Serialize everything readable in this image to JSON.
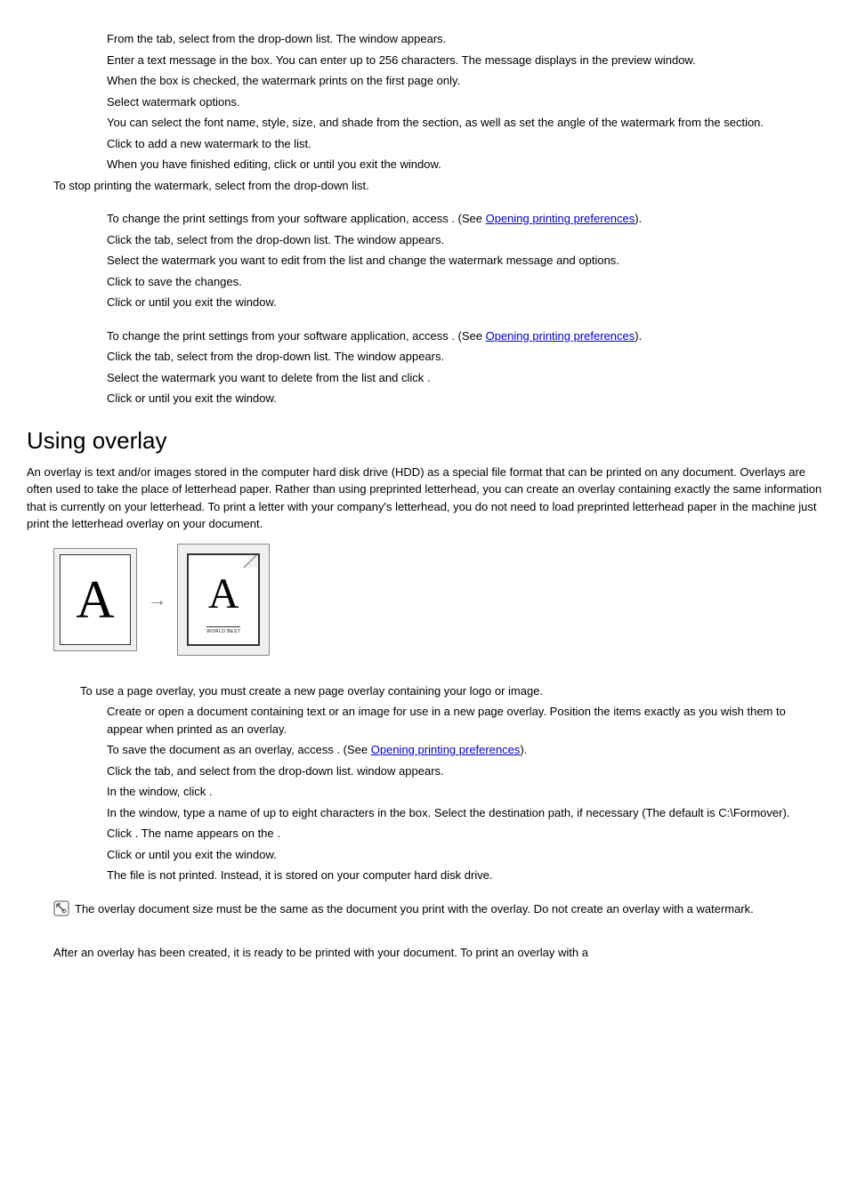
{
  "section1": {
    "p1": "From the tab, select from the drop-down list. The window appears.",
    "p2": "Enter a text message in the box. You can enter up to 256 characters. The message displays in the preview window.",
    "p3": "When the box is checked, the watermark prints on the first page only.",
    "p4": "Select watermark options.",
    "p5": "You can select the font name, style, size, and shade from the section, as well as set the angle of the watermark from the section.",
    "p6": "Click to add a new watermark to the list.",
    "p7": "When you have finished editing, click or until you exit the window.",
    "p8": "To stop printing the watermark, select from the drop-down list."
  },
  "section2": {
    "p1a": "To change the print settings from your software application, access ",
    "p1b": ". (See ",
    "link1": "Opening printing preferences",
    "p1c": ").",
    "p2": "Click the tab, select from the drop-down list. The window appears.",
    "p3": "Select the watermark you want to edit from the list and change the watermark message and options.",
    "p4": "Click to save the changes.",
    "p5": "Click or until you exit the window."
  },
  "section3": {
    "p1a": "To change the print settings from your software application, access ",
    "p1b": ". (See ",
    "link1": "Opening printing preferences",
    "p1c": ").",
    "p2": "Click the tab, select from the drop-down list. The window appears.",
    "p3": "Select the watermark you want to delete from the list and click .",
    "p4": "Click or until you exit the window."
  },
  "heading": "Using overlay",
  "overlay_intro": "An overlay is text and/or images stored in the computer hard disk drive (HDD) as a special file format that can be printed on any document. Overlays are often used to take the place of letterhead paper. Rather than using preprinted letterhead, you can create an overlay containing exactly the same information that is currently on your letterhead. To print a letter with your company's letterhead, you do not need to load preprinted letterhead paper in the machine just print the letterhead overlay on your document.",
  "fig_caption": "WORLD BEST",
  "section4": {
    "intro": "To use a page overlay, you must create a new page overlay containing your logo or image.",
    "p1": "Create or open a document containing text or an image for use in a new page overlay. Position the items exactly as you wish them to appear when printed as an overlay.",
    "p2a": "To save the document as an overlay, access ",
    "p2b": ". (See ",
    "link1": "Opening printing preferences",
    "p2c": ").",
    "p3": "Click the tab, and select from the drop-down list. window appears.",
    "p4": "In the window, click .",
    "p5": "In the window, type a name of up to eight characters in the box. Select the destination path, if necessary (The default is C:\\Formover).",
    "p6": "Click . The name appears on the .",
    "p7": "Click or until you exit the window.",
    "p8": "The file is not printed. Instead, it is stored on your computer hard disk drive."
  },
  "note": "The overlay document size must be the same as the document you print with the overlay. Do not create an overlay with a watermark.",
  "footer": "After an overlay has been created, it is ready to be printed with your document. To print an overlay with a"
}
